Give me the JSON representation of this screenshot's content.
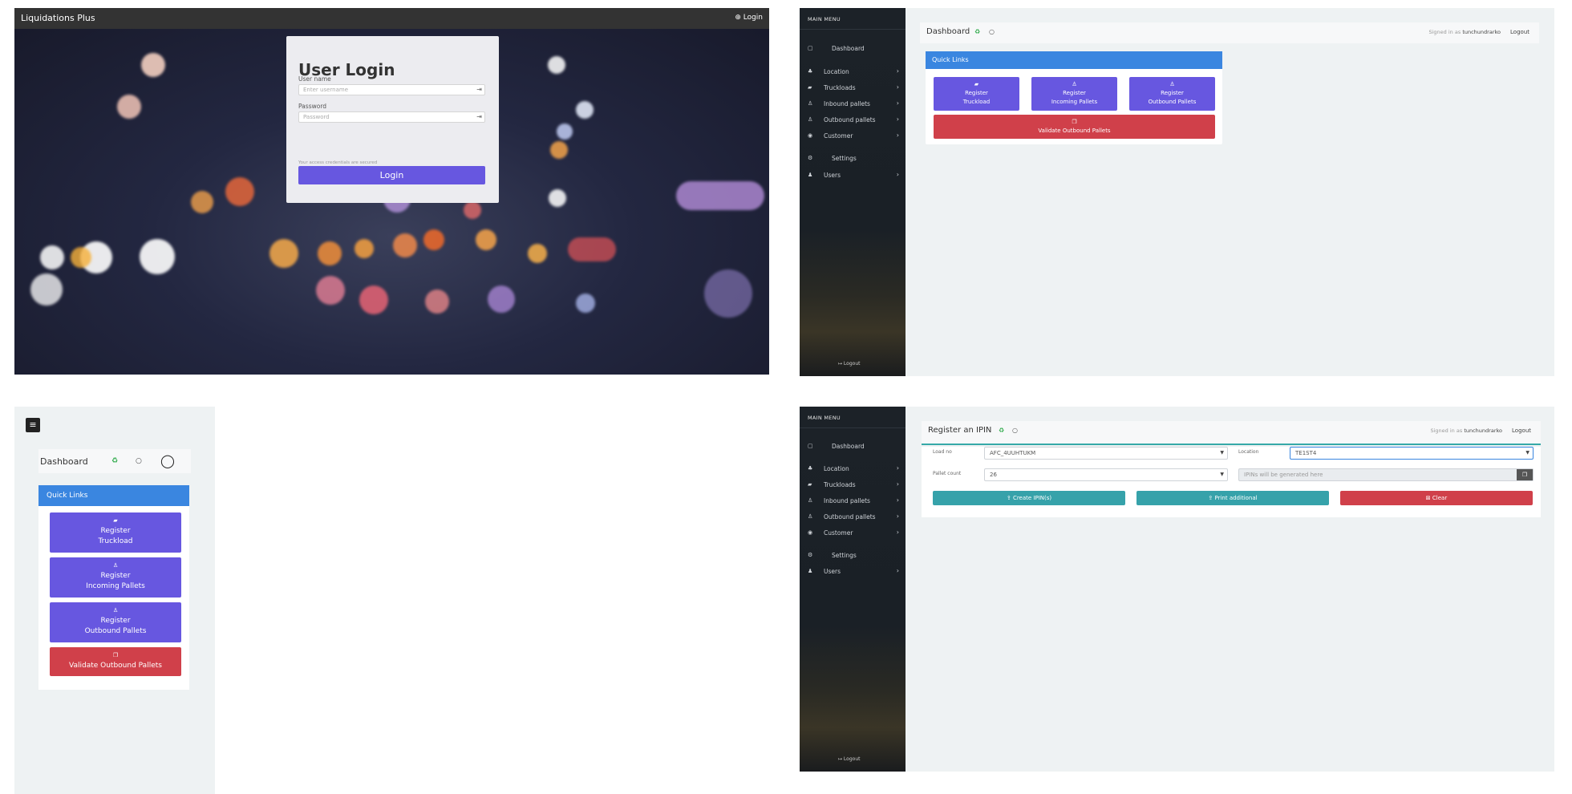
{
  "login": {
    "brand": "Liquidations Plus",
    "top_login": "⊕ Login",
    "title": "User Login",
    "username_label": "User name",
    "username_placeholder": "Enter username",
    "password_label": "Password",
    "password_placeholder": "Password",
    "secure_note": "Your access credentials are secured",
    "login_button": "Login"
  },
  "sidebar": {
    "heading": "MAIN MENU",
    "items": [
      {
        "label": "Dashboard",
        "icon": "▢",
        "chevron": ""
      },
      {
        "label": "Location",
        "icon": "♣",
        "chevron": "›"
      },
      {
        "label": "Truckloads",
        "icon": "▰",
        "chevron": "›"
      },
      {
        "label": "Inbound pallets",
        "icon": "♙",
        "chevron": "›"
      },
      {
        "label": "Outbound pallets",
        "icon": "♙",
        "chevron": "›"
      },
      {
        "label": "Customer",
        "icon": "◉",
        "chevron": "›"
      },
      {
        "label": "Settings",
        "icon": "⚙",
        "chevron": ""
      },
      {
        "label": "Users",
        "icon": "♟",
        "chevron": "›"
      }
    ],
    "logout": "↦ Logout"
  },
  "dashboard": {
    "title": "Dashboard",
    "signed_in_prefix": "Signed in as",
    "username": "tunchundrarko",
    "logout": "Logout",
    "quick_links": "Quick Links",
    "btn_truckload_1": "Register",
    "btn_truckload_2": "Truckload",
    "btn_incoming_1": "Register",
    "btn_incoming_2": "Incoming Pallets",
    "btn_outbound_1": "Register",
    "btn_outbound_2": "Outbound Pallets",
    "btn_validate": "Validate Outbound Pallets"
  },
  "mobile": {
    "menu_glyph": "≡",
    "title": "Dashboard"
  },
  "ipin": {
    "title": "Register an IPIN",
    "signed_in_prefix": "Signed in as",
    "username": "tunchundrarko",
    "logout": "Logout",
    "load_label": "Load no",
    "load_value": "AFC_4UUHTUKM",
    "location_label": "Location",
    "location_value": "TE1ST4",
    "pallet_label": "Pallet count",
    "pallet_value": "26",
    "ipin_placeholder": "IPINs will be generated here",
    "btn_create": "⇪ Create IPIN(s)",
    "btn_print": "⇪ Print additional",
    "btn_clear": "⊠ Clear"
  },
  "colors": {
    "primary": "#6757e0",
    "danger": "#d0404a",
    "info": "#3a86e0",
    "teal": "#36a2aa",
    "success_icon": "#2eaa4a"
  },
  "icons": {
    "status": "♻",
    "circle": "○",
    "user": "◯"
  }
}
